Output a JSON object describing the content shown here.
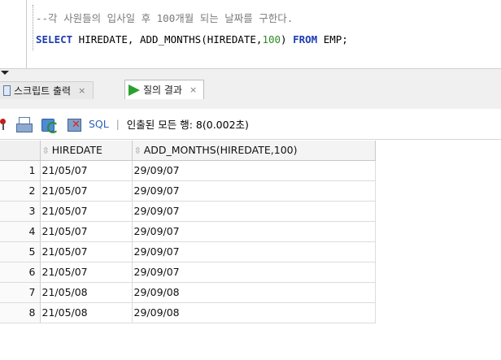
{
  "editor": {
    "comment_line": "--각 사원들의 입사일 후 100개월 되는 날짜를 구한다.",
    "sql": {
      "kw_select": "SELECT",
      "part1": " HIREDATE, ADD_MONTHS(HIREDATE,",
      "number": "100",
      "part2": ") ",
      "kw_from": "FROM",
      "part3": " EMP;"
    }
  },
  "tabs": [
    {
      "label": "스크립트 출력",
      "close": "×",
      "active": false
    },
    {
      "label": "질의 결과",
      "close": "×",
      "active": true
    }
  ],
  "toolbar": {
    "sql_label": "SQL",
    "separator": "|",
    "status": "인출된 모든 행: 8(0.002초)"
  },
  "icons": {
    "tab_script": "script-page-icon",
    "tab_result": "run-play-icon",
    "toolbar": [
      "pin-icon",
      "print-icon",
      "refresh-icon",
      "cancel-query-icon"
    ],
    "sort": "sort-icon"
  },
  "colors": {
    "keyword": "#1d3bb1",
    "number": "#2e8b22",
    "comment": "#7a7a7a",
    "sql_link": "#2f62b8",
    "play_icon": "#2aa12f"
  },
  "grid": {
    "sort_glyph": "⇳",
    "columns": [
      "HIREDATE",
      "ADD_MONTHS(HIREDATE,100)"
    ],
    "rows": [
      {
        "n": "1",
        "hiredate": "21/05/07",
        "add_months": "29/09/07"
      },
      {
        "n": "2",
        "hiredate": "21/05/07",
        "add_months": "29/09/07"
      },
      {
        "n": "3",
        "hiredate": "21/05/07",
        "add_months": "29/09/07"
      },
      {
        "n": "4",
        "hiredate": "21/05/07",
        "add_months": "29/09/07"
      },
      {
        "n": "5",
        "hiredate": "21/05/07",
        "add_months": "29/09/07"
      },
      {
        "n": "6",
        "hiredate": "21/05/07",
        "add_months": "29/09/07"
      },
      {
        "n": "7",
        "hiredate": "21/05/08",
        "add_months": "29/09/08"
      },
      {
        "n": "8",
        "hiredate": "21/05/08",
        "add_months": "29/09/08"
      }
    ]
  }
}
